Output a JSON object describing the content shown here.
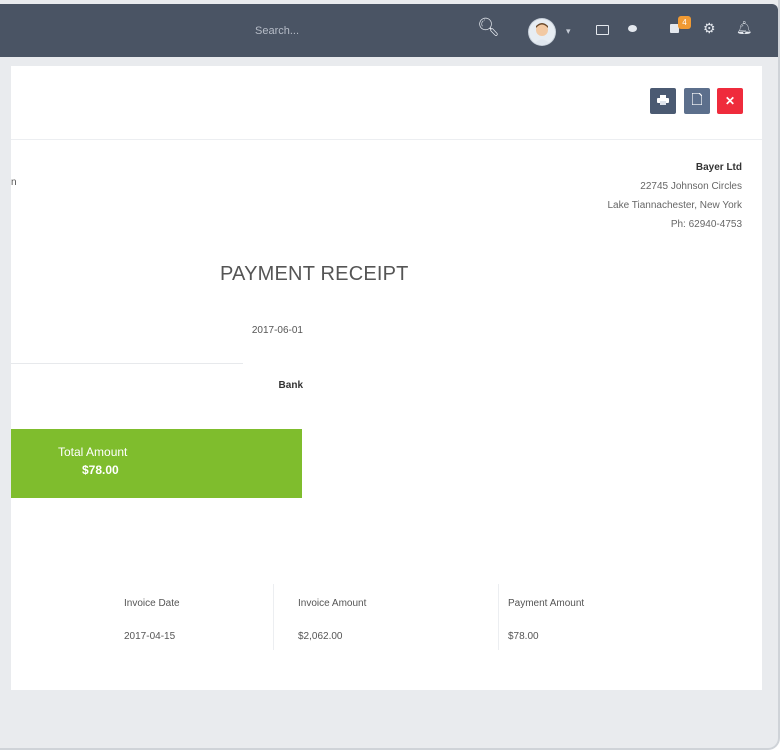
{
  "topbar": {
    "search_placeholder": "Search...",
    "notification_count": "4",
    "icons": [
      "search-icon",
      "user-avatar",
      "chevron-down-icon",
      "mail-icon",
      "chat-icon",
      "shopping-bag-icon",
      "gear-icon",
      "bell-icon"
    ]
  },
  "actions": {
    "print_icon": "print-icon",
    "pdf_icon": "file-icon",
    "close_icon": "close-icon",
    "close_color": "#ef2b3c"
  },
  "company": {
    "name": "Bayer Ltd",
    "line1": "22745 Johnson Circles",
    "line2": "Lake Tiannachester, New York",
    "line3": "Ph: 62940-4753"
  },
  "left_fragment": "n",
  "receipt": {
    "title": "PAYMENT RECEIPT",
    "payment_date": "2017-06-01",
    "payment_method": "Bank"
  },
  "total": {
    "label": "Total Amount",
    "value": "$78.00",
    "color": "#7fbd2d"
  },
  "table": {
    "headers": [
      "Invoice Date",
      "Invoice Amount",
      "Payment Amount"
    ],
    "rows": [
      [
        "2017-04-15",
        "$2,062.00",
        "$78.00"
      ]
    ]
  }
}
